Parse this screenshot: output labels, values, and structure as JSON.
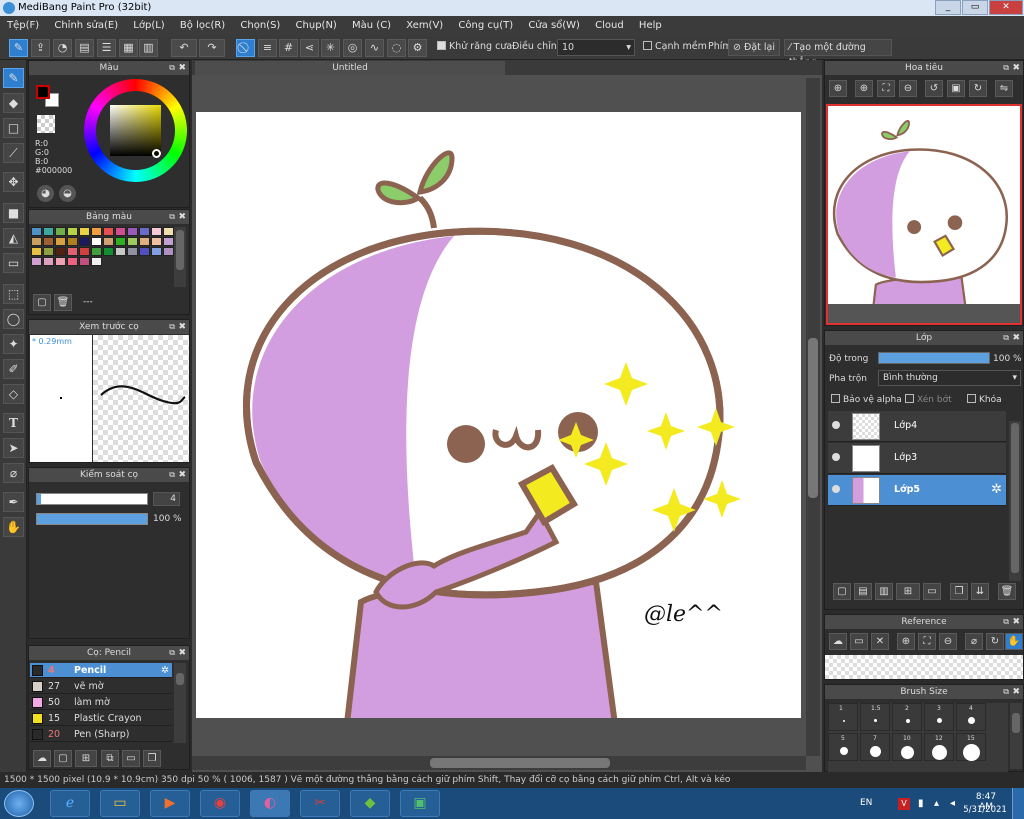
{
  "window": {
    "title": "MediBang Paint Pro (32bit)",
    "minimize": "_",
    "maximize": "▭",
    "close": "✕"
  },
  "menu": [
    "Tệp(F)",
    "Chỉnh sửa(E)",
    "Lớp(L)",
    "Bộ lọc(R)",
    "Chọn(S)",
    "Chụp(N)",
    "Màu (C)",
    "Xem(V)",
    "Công cụ(T)",
    "Cửa sổ(W)",
    "Cloud",
    "Help"
  ],
  "toolbar": {
    "antialias_label": "Khử răng cưa",
    "adjust_label": "Điều chỉnh",
    "adjust_value": "10",
    "soft_edge_label": "Cạnh mềm",
    "key_label": "Phím",
    "reset_label": "Đặt lại",
    "line_label": "Tạo một đường thẳng"
  },
  "color_panel": {
    "title": "Màu",
    "r": "R:0",
    "g": "G:0",
    "b": "B:0",
    "hex": "#000000",
    "primary": "#000000",
    "secondary": "#ffffff"
  },
  "palette_panel": {
    "title": "Bảng màu",
    "swatches": [
      "#4f94c8",
      "#3fa8a0",
      "#6fb04a",
      "#b8d24a",
      "#e8d24a",
      "#f0a040",
      "#e85050",
      "#d04f90",
      "#9a5ab8",
      "#6a6ac8",
      "#f6c8d8",
      "#f0e0b0",
      "#c8a060",
      "#a06030",
      "#d8a040",
      "#b08020",
      "#1a1a60",
      "#ffffff",
      "#d0a070",
      "#30b020",
      "#a0c860",
      "#e0b080",
      "#f0c0a0",
      "#c0a0d0",
      "#e8c040",
      "#90a040",
      "#502010",
      "#e06070",
      "#d04040",
      "#40a040",
      "#109030",
      "#c8c8c8",
      "#9090a0",
      "#5050c0",
      "#80a0e0",
      "#b090c0",
      "#d0a0d0",
      "#e0a0c0",
      "#f0a0b0",
      "#f06080",
      "#c05080",
      "#f0f0f0"
    ],
    "footer_text": "---"
  },
  "preview_panel": {
    "title": "Xem trước cọ",
    "size": "* 0.29mm"
  },
  "brush_control": {
    "title": "Kiểm soát cọ",
    "size_value": "4",
    "opacity_value": "100 %",
    "size_fraction": 0.04,
    "opacity_fraction": 1.0
  },
  "brush_panel": {
    "title": "Cọ: Pencil",
    "brushes": [
      {
        "size": "4",
        "name": "Pencil",
        "color": "#2a2a2a"
      },
      {
        "size": "27",
        "name": "vẽ mờ",
        "color": "#d8d0c8"
      },
      {
        "size": "50",
        "name": "làm mờ",
        "color": "#f4a8e8"
      },
      {
        "size": "15",
        "name": "Plastic Crayon (thick)",
        "color": "#f0e020"
      },
      {
        "size": "20",
        "name": "Pen (Sharp)",
        "color": "#2a2a2a"
      }
    ]
  },
  "canvas": {
    "tab_title": "Untitled",
    "signature": "@le^^"
  },
  "navigator": {
    "title": "Hoa tiêu"
  },
  "layers_panel": {
    "title": "Lớp",
    "opacity_label": "Độ trong",
    "opacity_value": "100 %",
    "opacity_fraction": 1.0,
    "blend_label": "Pha trộn",
    "blend_value": "Bình thường",
    "protect_alpha": "Bảo vệ alpha",
    "clip": "Xén bớt",
    "lock": "Khóa",
    "layers": [
      "Lớp4",
      "Lớp3",
      "Lớp5"
    ]
  },
  "reference_panel": {
    "title": "Reference"
  },
  "brushsize_panel": {
    "title": "Brush Size",
    "sizes_row1": [
      "1",
      "1.5",
      "2",
      "3",
      "4"
    ],
    "sizes_row2": [
      "5",
      "7",
      "10",
      "12",
      "15"
    ]
  },
  "status": {
    "text": "1500 * 1500 pixel   (10.9 * 10.9cm)   350 dpi   50 %   ( 1006, 1587 )   Vẽ một đường thẳng bằng cách giữ phím Shift, Thay đổi cỡ cọ bằng cách giữ phím Ctrl, Alt và kéo"
  },
  "taskbar": {
    "lang": "EN",
    "time": "8:47 AM",
    "date": "5/31/2021"
  },
  "colors": {
    "accent": "#4d8fd3",
    "skin_purple": "#d39ee0",
    "outline_brown": "#8c6350",
    "leaf_green": "#8ccc6a",
    "sparkle": "#f4ea20"
  }
}
